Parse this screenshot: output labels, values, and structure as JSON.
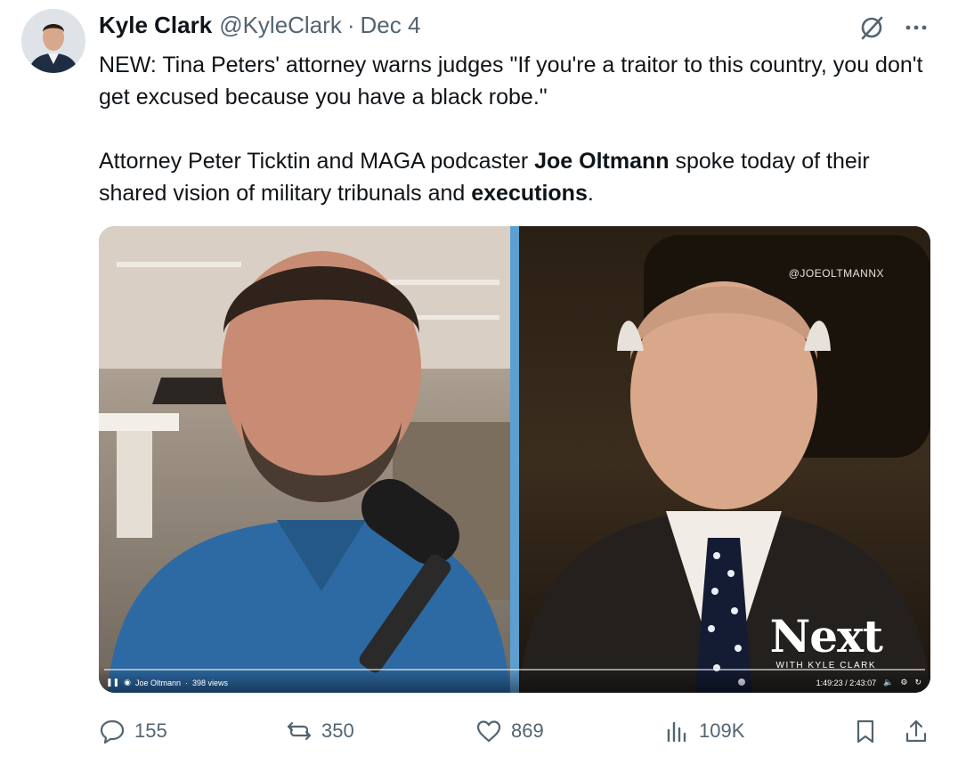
{
  "tweet": {
    "author_name": "Kyle Clark",
    "handle": "@KyleClark",
    "separator": "·",
    "date": "Dec 4",
    "text": {
      "line1": "NEW: Tina Peters' attorney warns judges \"If you're a traitor to this country, you don't get excused because you have a black robe.\"",
      "p2_start": "Attorney Peter Ticktin and MAGA podcaster ",
      "p2_bold1": "Joe Oltmann",
      "p2_mid": " spoke today of their shared vision of military tribunals and ",
      "p2_bold2": "executions",
      "p2_end": "."
    }
  },
  "media": {
    "watermark": "@JOEOLTMANNX",
    "brand_main": "Next",
    "brand_sub": "WITH KYLE CLARK",
    "player": {
      "channel": "Joe Oltmann",
      "separator": "·",
      "views": "398 views",
      "time": "1:49:23 / 2:43:07"
    }
  },
  "actions": {
    "replies": "155",
    "reposts": "350",
    "likes": "869",
    "views": "109K"
  },
  "colors": {
    "text": "#0f1419",
    "muted": "#536471",
    "divider": "#5c9fd0"
  }
}
